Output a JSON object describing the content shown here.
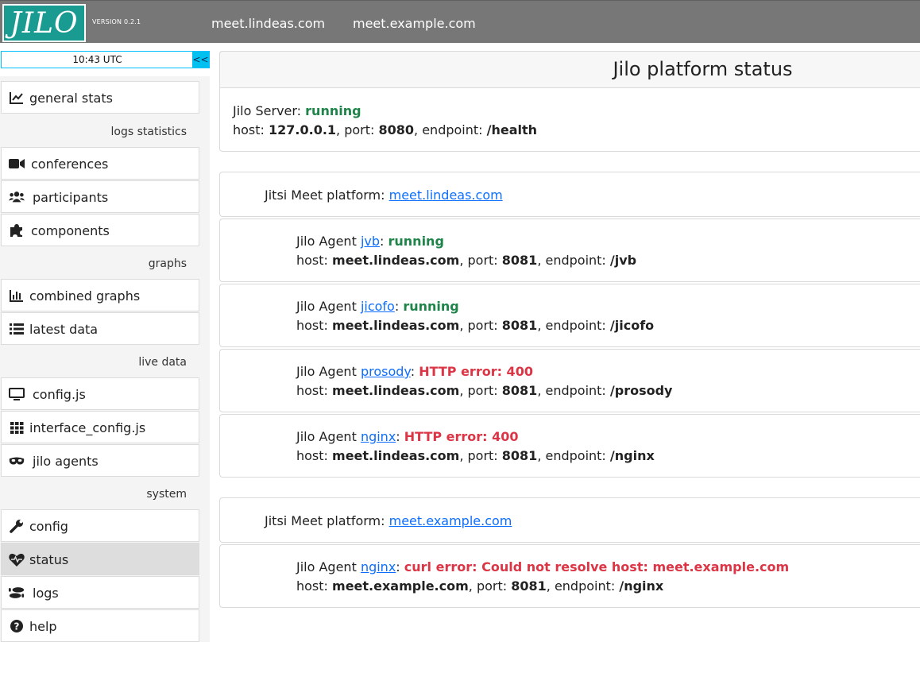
{
  "header": {
    "logo_text": "JILO",
    "version": "VERSION 0.2.1",
    "platforms": [
      "meet.lindeas.com",
      "meet.example.com"
    ]
  },
  "clock": {
    "time": "10:43  UTC",
    "collapse_label": "<<"
  },
  "sidebar": {
    "general": {
      "label": "general stats",
      "icon": "chart-line-icon"
    },
    "sections": {
      "logs": "logs statistics",
      "graphs": "graphs",
      "live": "live data",
      "system": "system"
    },
    "items": {
      "conferences": {
        "label": "conferences",
        "icon": "video-icon"
      },
      "participants": {
        "label": "participants",
        "icon": "users-icon"
      },
      "components": {
        "label": "components",
        "icon": "puzzle-icon"
      },
      "combined_graphs": {
        "label": "combined graphs",
        "icon": "bar-chart-icon"
      },
      "latest_data": {
        "label": "latest data",
        "icon": "list-icon"
      },
      "config_js": {
        "label": "config.js",
        "icon": "monitor-icon"
      },
      "interface_config": {
        "label": "interface_config.js",
        "icon": "grid-icon"
      },
      "jilo_agents": {
        "label": "jilo agents",
        "icon": "mask-icon"
      },
      "config": {
        "label": "config",
        "icon": "wrench-icon"
      },
      "status": {
        "label": "status",
        "icon": "heartbeat-icon",
        "active": true
      },
      "logs": {
        "label": "logs",
        "icon": "shoe-prints-icon"
      },
      "help": {
        "label": "help",
        "icon": "question-circle-icon"
      }
    }
  },
  "main": {
    "title": "Jilo platform status",
    "server": {
      "prefix": "Jilo Server: ",
      "state": "running",
      "host": "127.0.0.1",
      "port": "8080",
      "endpoint": "/health"
    },
    "labels": {
      "host": "host: ",
      "port": ", port: ",
      "endpoint": ", endpoint: ",
      "platform": "Jitsi Meet platform: ",
      "agent": "Jilo Agent ",
      "colon": ": "
    },
    "platforms": [
      {
        "name": "meet.lindeas.com",
        "agents": [
          {
            "name": "jvb",
            "state": "running",
            "host": "meet.lindeas.com",
            "port": "8081",
            "endpoint": "/jvb"
          },
          {
            "name": "jicofo",
            "state": "running",
            "host": "meet.lindeas.com",
            "port": "8081",
            "endpoint": "/jicofo"
          },
          {
            "name": "prosody",
            "state": "HTTP error: 400",
            "host": "meet.lindeas.com",
            "port": "8081",
            "endpoint": "/prosody"
          },
          {
            "name": "nginx",
            "state": "HTTP error: 400",
            "host": "meet.lindeas.com",
            "port": "8081",
            "endpoint": "/nginx"
          }
        ]
      },
      {
        "name": "meet.example.com",
        "agents": [
          {
            "name": "nginx",
            "state": "curl error: Could not resolve host: meet.example.com",
            "host": "meet.example.com",
            "port": "8081",
            "endpoint": "/nginx"
          }
        ]
      }
    ]
  },
  "colors": {
    "header_bg": "#777777",
    "logo_bg": "#1a9b92",
    "running": "#1e8449",
    "error": "#dc3545",
    "link": "#0d6efd",
    "clock_accent": "#00c0ef"
  }
}
